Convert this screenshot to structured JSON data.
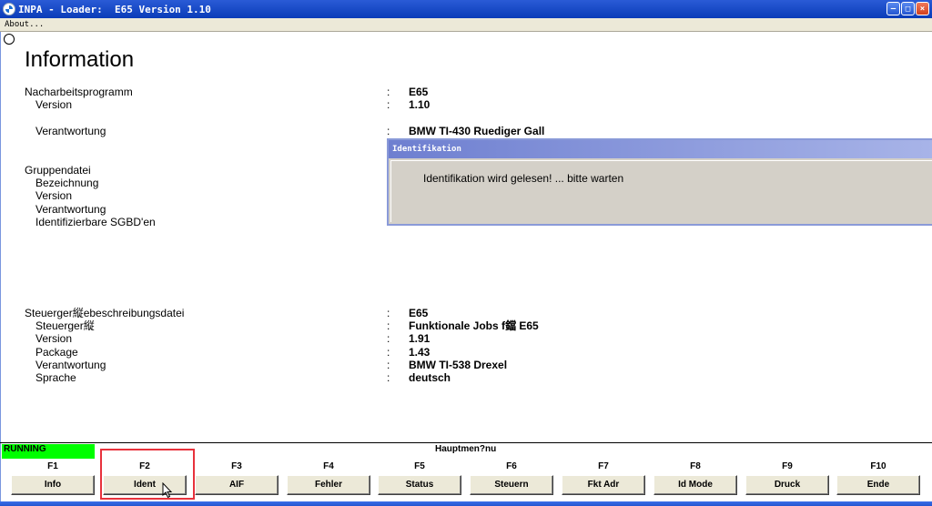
{
  "window": {
    "title": "INPA - Loader:  E65 Version 1.10"
  },
  "menu": {
    "about": "About..."
  },
  "info": {
    "heading": "Information",
    "rows": [
      {
        "label": "Nacharbeitsprogramm",
        "value": "E65"
      },
      {
        "label": "Version",
        "value": "1.10"
      },
      {
        "label": "Verantwortung",
        "value": "BMW TI-430 Ruediger Gall"
      }
    ],
    "group": {
      "label": "Gruppendatei",
      "items": [
        "Bezeichnung",
        "Version",
        "Verantwortung",
        "Identifizierbare SGBD'en"
      ]
    },
    "ecu": {
      "label": "Steuerger縦ebeschreibungsdatei",
      "value": "E65",
      "items": [
        {
          "label": "Steuerger縦",
          "value": "Funktionale Jobs f鐺 E65"
        },
        {
          "label": "Version",
          "value": "1.91"
        },
        {
          "label": "Package",
          "value": "1.43"
        },
        {
          "label": "Verantwortung",
          "value": "BMW TI-538 Drexel"
        },
        {
          "label": "Sprache",
          "value": "deutsch"
        }
      ]
    },
    "colon": ":"
  },
  "dialog": {
    "title": "Identifikation",
    "message": "Identifikation wird gelesen! ... bitte warten"
  },
  "status": {
    "running": "RUNNING",
    "menu_title": "Hauptmen?nu"
  },
  "fkeys": [
    {
      "key": "F1",
      "label": "Info"
    },
    {
      "key": "F2",
      "label": "Ident"
    },
    {
      "key": "F3",
      "label": "AIF"
    },
    {
      "key": "F4",
      "label": "Fehler"
    },
    {
      "key": "F5",
      "label": "Status"
    },
    {
      "key": "F6",
      "label": "Steuern"
    },
    {
      "key": "F7",
      "label": "Fkt Adr"
    },
    {
      "key": "F8",
      "label": "Id Mode"
    },
    {
      "key": "F9",
      "label": "Druck"
    },
    {
      "key": "F10",
      "label": "Ende"
    }
  ],
  "colors": {
    "running_bg": "#00ff00",
    "highlight": "#e8323c",
    "titlebar": "#0a3cb8"
  }
}
